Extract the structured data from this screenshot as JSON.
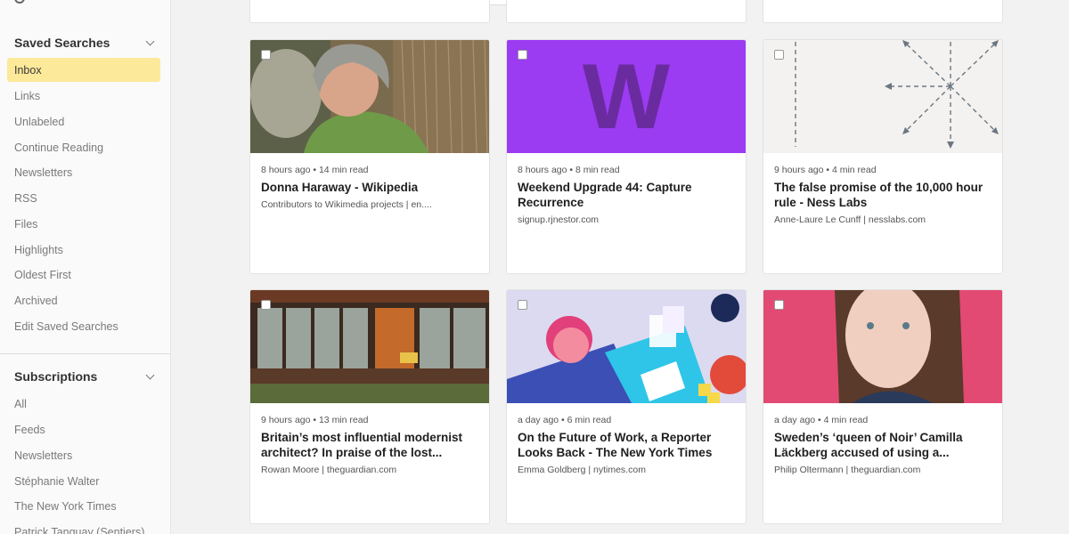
{
  "sidebar": {
    "saved": {
      "title": "Saved Searches",
      "items": [
        "Inbox",
        "Links",
        "Unlabeled",
        "Continue Reading",
        "Newsletters",
        "RSS",
        "Files",
        "Highlights",
        "Oldest First",
        "Archived",
        "Edit Saved Searches"
      ]
    },
    "subscriptions": {
      "title": "Subscriptions",
      "items": [
        "All",
        "Feeds",
        "Newsletters",
        "Stéphanie Walter",
        "The New York Times",
        "Patrick Tanguay (Sentiers)"
      ]
    }
  },
  "cards": [
    {
      "meta": "8 hours ago • 14 min read",
      "title": "Donna Haraway - Wikipedia",
      "source": "Contributors to Wikimedia projects | en...."
    },
    {
      "meta": "8 hours ago • 8 min read",
      "title": "Weekend Upgrade 44: Capture Recurrence",
      "source": "signup.rjnestor.com",
      "thumb_letter": "W"
    },
    {
      "meta": "9 hours ago • 4 min read",
      "title": "The false promise of the 10,000 hour rule - Ness Labs",
      "source": "Anne-Laure Le Cunff | nesslabs.com"
    },
    {
      "meta": "9 hours ago • 13 min read",
      "title": "Britain’s most influential modernist architect? In praise of the lost...",
      "source": "Rowan Moore | theguardian.com"
    },
    {
      "meta": "a day ago • 6 min read",
      "title": "On the Future of Work, a Reporter Looks Back - The New York Times",
      "source": "Emma Goldberg | nytimes.com"
    },
    {
      "meta": "a day ago • 4 min read",
      "title": "Sweden’s ‘queen of Noir’ Camilla Läckberg accused of using a...",
      "source": "Philip Oltermann | theguardian.com"
    }
  ],
  "colors": {
    "accent": "#fde99a",
    "purple": "#9b3bf2",
    "purple_letter": "#6a2b9f",
    "pink": "#e24a74"
  }
}
